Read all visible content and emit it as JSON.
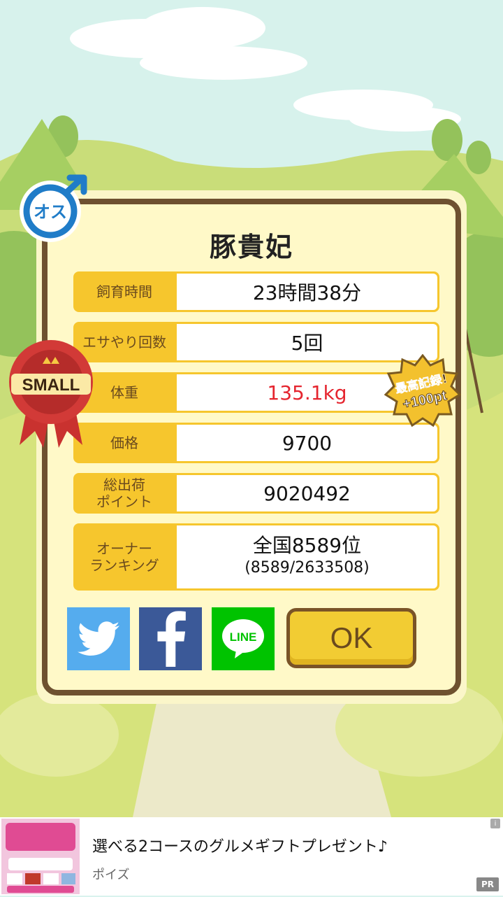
{
  "result": {
    "pet_name": "豚貴妃",
    "rows": [
      {
        "label": "飼育時間",
        "value": "23時間38分"
      },
      {
        "label": "エサやり回数",
        "value": "5回"
      },
      {
        "label": "体重",
        "value": "135.1kg"
      },
      {
        "label": "価格",
        "value": "9700"
      },
      {
        "label": "総出荷\nポイント",
        "value": "9020492"
      },
      {
        "label": "オーナー\nランキング",
        "value": "全国8589位",
        "value_sub": "(8589/2633508)"
      }
    ],
    "gender_badge": "オス",
    "size_badge": "SMALL",
    "record_badge_line1": "最高記録!",
    "record_badge_line2": "+100pt",
    "ok_label": "OK",
    "share": {
      "line_label": "LINE"
    }
  },
  "ad": {
    "title": "選べる2コースのグルメギフトプレゼント♪",
    "brand": "ポイズ",
    "pr_label": "PR",
    "info_label": "i"
  },
  "colors": {
    "row_label_bg": "#f6c62d",
    "dialog_border": "#6e5130",
    "weight_value": "#e5252f",
    "twitter": "#55acee",
    "facebook": "#3b5998",
    "line": "#00c300"
  }
}
